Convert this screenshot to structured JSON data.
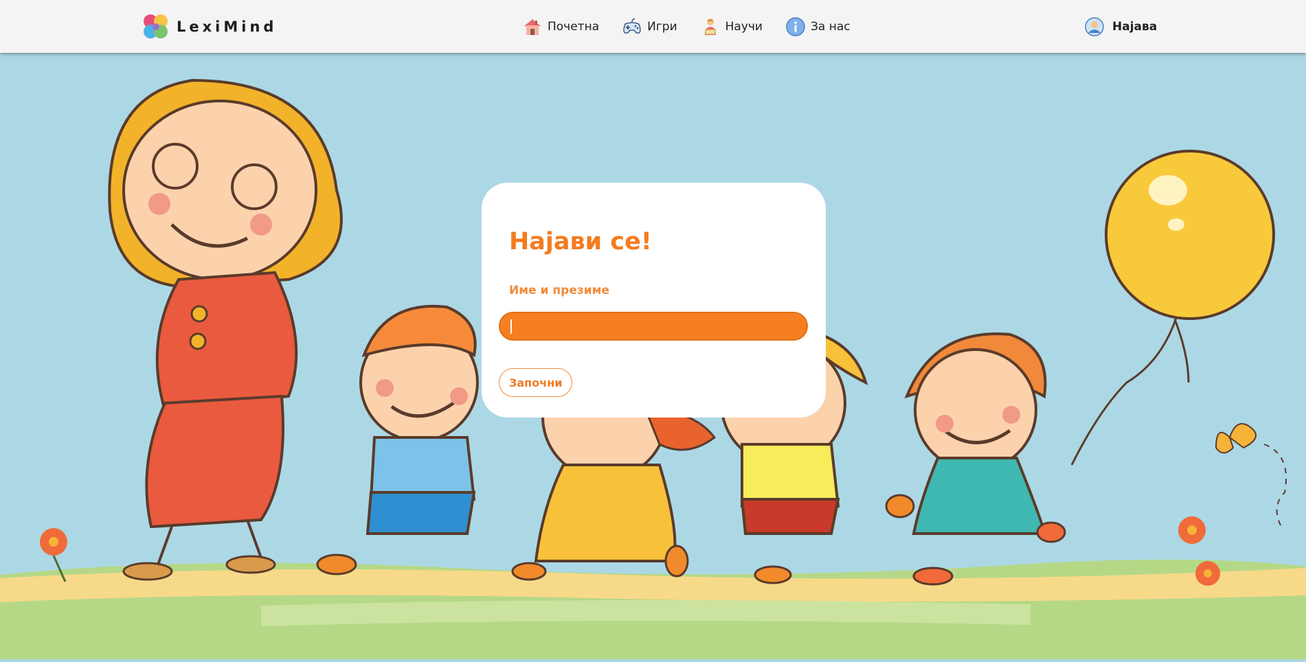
{
  "brand": {
    "name": "LexiMind",
    "logo_icon": "puzzle-brain-logo-icon"
  },
  "nav": {
    "items": [
      {
        "label": "Почетна",
        "icon": "home-icon"
      },
      {
        "label": "Игри",
        "icon": "gamepad-icon"
      },
      {
        "label": "Научи",
        "icon": "student-book-icon"
      },
      {
        "label": "За нас",
        "icon": "info-icon"
      }
    ],
    "login": {
      "label": "Најава",
      "icon": "user-avatar-icon"
    }
  },
  "login_card": {
    "title": "Најави се!",
    "name_label": "Име и презиме",
    "name_value": "",
    "start_button": "Започни"
  },
  "colors": {
    "accent": "#f47b20",
    "input_fill": "#f67f22",
    "background_sky": "#acd8e5",
    "navbar": "#f4f4f4"
  },
  "hero_image": "cartoon teacher and four children holding hands walking on a path with a yellow balloon"
}
